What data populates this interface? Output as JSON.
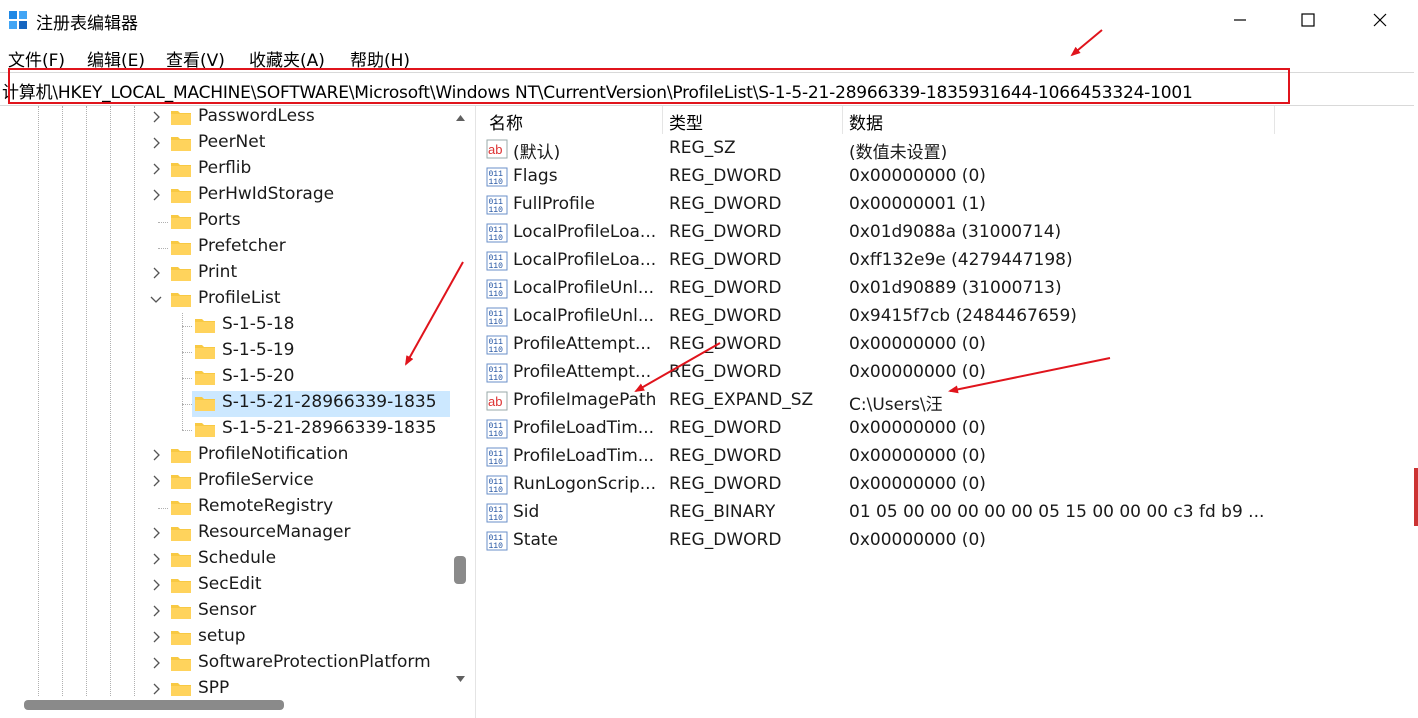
{
  "window": {
    "title": "注册表编辑器",
    "controls": [
      "minimize",
      "maximize",
      "close"
    ]
  },
  "menu": [
    "文件(F)",
    "编辑(E)",
    "查看(V)",
    "收藏夹(A)",
    "帮助(H)"
  ],
  "address": "计算机\\HKEY_LOCAL_MACHINE\\SOFTWARE\\Microsoft\\Windows NT\\CurrentVersion\\ProfileList\\S-1-5-21-28966339-1835931644-1066453324-1001",
  "tree": [
    {
      "label": "PasswordLess",
      "level": 0,
      "expandable": true
    },
    {
      "label": "PeerNet",
      "level": 0,
      "expandable": true
    },
    {
      "label": "Perflib",
      "level": 0,
      "expandable": true
    },
    {
      "label": "PerHwIdStorage",
      "level": 0,
      "expandable": true
    },
    {
      "label": "Ports",
      "level": 0,
      "expandable": false
    },
    {
      "label": "Prefetcher",
      "level": 0,
      "expandable": false
    },
    {
      "label": "Print",
      "level": 0,
      "expandable": true
    },
    {
      "label": "ProfileList",
      "level": 0,
      "expandable": true,
      "expanded": true
    },
    {
      "label": "S-1-5-18",
      "level": 1,
      "expandable": false
    },
    {
      "label": "S-1-5-19",
      "level": 1,
      "expandable": false
    },
    {
      "label": "S-1-5-20",
      "level": 1,
      "expandable": false
    },
    {
      "label": "S-1-5-21-28966339-1835",
      "level": 1,
      "expandable": false,
      "selected": true
    },
    {
      "label": "S-1-5-21-28966339-1835",
      "level": 1,
      "expandable": false
    },
    {
      "label": "ProfileNotification",
      "level": 0,
      "expandable": true
    },
    {
      "label": "ProfileService",
      "level": 0,
      "expandable": true
    },
    {
      "label": "RemoteRegistry",
      "level": 0,
      "expandable": false
    },
    {
      "label": "ResourceManager",
      "level": 0,
      "expandable": true
    },
    {
      "label": "Schedule",
      "level": 0,
      "expandable": true
    },
    {
      "label": "SecEdit",
      "level": 0,
      "expandable": true
    },
    {
      "label": "Sensor",
      "level": 0,
      "expandable": true
    },
    {
      "label": "setup",
      "level": 0,
      "expandable": true
    },
    {
      "label": "SoftwareProtectionPlatform",
      "level": 0,
      "expandable": true
    },
    {
      "label": "SPP",
      "level": 0,
      "expandable": true
    }
  ],
  "columns": [
    "名称",
    "类型",
    "数据"
  ],
  "values": [
    {
      "icon": "string-value-icon",
      "name": "(默认)",
      "type": "REG_SZ",
      "data": "(数值未设置)"
    },
    {
      "icon": "binary-value-icon",
      "name": "Flags",
      "type": "REG_DWORD",
      "data": "0x00000000 (0)"
    },
    {
      "icon": "binary-value-icon",
      "name": "FullProfile",
      "type": "REG_DWORD",
      "data": "0x00000001 (1)"
    },
    {
      "icon": "binary-value-icon",
      "name": "LocalProfileLoa...",
      "type": "REG_DWORD",
      "data": "0x01d9088a (31000714)"
    },
    {
      "icon": "binary-value-icon",
      "name": "LocalProfileLoa...",
      "type": "REG_DWORD",
      "data": "0xff132e9e (4279447198)"
    },
    {
      "icon": "binary-value-icon",
      "name": "LocalProfileUnl...",
      "type": "REG_DWORD",
      "data": "0x01d90889 (31000713)"
    },
    {
      "icon": "binary-value-icon",
      "name": "LocalProfileUnl...",
      "type": "REG_DWORD",
      "data": "0x9415f7cb (2484467659)"
    },
    {
      "icon": "binary-value-icon",
      "name": "ProfileAttempt...",
      "type": "REG_DWORD",
      "data": "0x00000000 (0)"
    },
    {
      "icon": "binary-value-icon",
      "name": "ProfileAttempt...",
      "type": "REG_DWORD",
      "data": "0x00000000 (0)"
    },
    {
      "icon": "string-value-icon",
      "name": "ProfileImagePath",
      "type": "REG_EXPAND_SZ",
      "data": "C:\\Users\\汪"
    },
    {
      "icon": "binary-value-icon",
      "name": "ProfileLoadTim...",
      "type": "REG_DWORD",
      "data": "0x00000000 (0)"
    },
    {
      "icon": "binary-value-icon",
      "name": "ProfileLoadTim...",
      "type": "REG_DWORD",
      "data": "0x00000000 (0)"
    },
    {
      "icon": "binary-value-icon",
      "name": "RunLogonScrip...",
      "type": "REG_DWORD",
      "data": "0x00000000 (0)"
    },
    {
      "icon": "binary-value-icon",
      "name": "Sid",
      "type": "REG_BINARY",
      "data": "01 05 00 00 00 00 00 05 15 00 00 00 c3 fd b9 ..."
    },
    {
      "icon": "binary-value-icon",
      "name": "State",
      "type": "REG_DWORD",
      "data": "0x00000000 (0)"
    }
  ],
  "colors": {
    "selection": "#cce8ff",
    "annotation": "#e0141c",
    "folder": "#f8c943"
  }
}
